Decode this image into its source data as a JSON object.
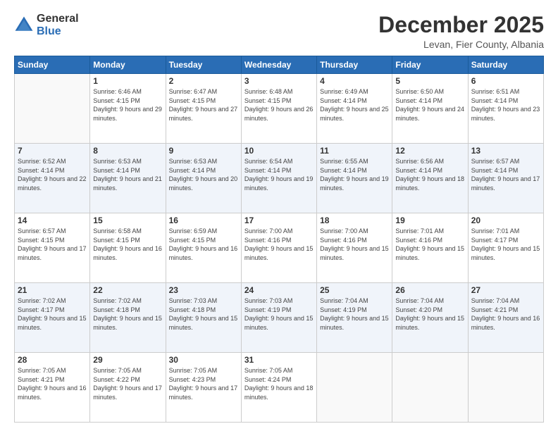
{
  "logo": {
    "general": "General",
    "blue": "Blue"
  },
  "title": {
    "month": "December 2025",
    "location": "Levan, Fier County, Albania"
  },
  "weekdays": [
    "Sunday",
    "Monday",
    "Tuesday",
    "Wednesday",
    "Thursday",
    "Friday",
    "Saturday"
  ],
  "weeks": [
    [
      {
        "day": "",
        "sunrise": "",
        "sunset": "",
        "daylight": ""
      },
      {
        "day": "1",
        "sunrise": "Sunrise: 6:46 AM",
        "sunset": "Sunset: 4:15 PM",
        "daylight": "Daylight: 9 hours and 29 minutes."
      },
      {
        "day": "2",
        "sunrise": "Sunrise: 6:47 AM",
        "sunset": "Sunset: 4:15 PM",
        "daylight": "Daylight: 9 hours and 27 minutes."
      },
      {
        "day": "3",
        "sunrise": "Sunrise: 6:48 AM",
        "sunset": "Sunset: 4:15 PM",
        "daylight": "Daylight: 9 hours and 26 minutes."
      },
      {
        "day": "4",
        "sunrise": "Sunrise: 6:49 AM",
        "sunset": "Sunset: 4:14 PM",
        "daylight": "Daylight: 9 hours and 25 minutes."
      },
      {
        "day": "5",
        "sunrise": "Sunrise: 6:50 AM",
        "sunset": "Sunset: 4:14 PM",
        "daylight": "Daylight: 9 hours and 24 minutes."
      },
      {
        "day": "6",
        "sunrise": "Sunrise: 6:51 AM",
        "sunset": "Sunset: 4:14 PM",
        "daylight": "Daylight: 9 hours and 23 minutes."
      }
    ],
    [
      {
        "day": "7",
        "sunrise": "Sunrise: 6:52 AM",
        "sunset": "Sunset: 4:14 PM",
        "daylight": "Daylight: 9 hours and 22 minutes."
      },
      {
        "day": "8",
        "sunrise": "Sunrise: 6:53 AM",
        "sunset": "Sunset: 4:14 PM",
        "daylight": "Daylight: 9 hours and 21 minutes."
      },
      {
        "day": "9",
        "sunrise": "Sunrise: 6:53 AM",
        "sunset": "Sunset: 4:14 PM",
        "daylight": "Daylight: 9 hours and 20 minutes."
      },
      {
        "day": "10",
        "sunrise": "Sunrise: 6:54 AM",
        "sunset": "Sunset: 4:14 PM",
        "daylight": "Daylight: 9 hours and 19 minutes."
      },
      {
        "day": "11",
        "sunrise": "Sunrise: 6:55 AM",
        "sunset": "Sunset: 4:14 PM",
        "daylight": "Daylight: 9 hours and 19 minutes."
      },
      {
        "day": "12",
        "sunrise": "Sunrise: 6:56 AM",
        "sunset": "Sunset: 4:14 PM",
        "daylight": "Daylight: 9 hours and 18 minutes."
      },
      {
        "day": "13",
        "sunrise": "Sunrise: 6:57 AM",
        "sunset": "Sunset: 4:14 PM",
        "daylight": "Daylight: 9 hours and 17 minutes."
      }
    ],
    [
      {
        "day": "14",
        "sunrise": "Sunrise: 6:57 AM",
        "sunset": "Sunset: 4:15 PM",
        "daylight": "Daylight: 9 hours and 17 minutes."
      },
      {
        "day": "15",
        "sunrise": "Sunrise: 6:58 AM",
        "sunset": "Sunset: 4:15 PM",
        "daylight": "Daylight: 9 hours and 16 minutes."
      },
      {
        "day": "16",
        "sunrise": "Sunrise: 6:59 AM",
        "sunset": "Sunset: 4:15 PM",
        "daylight": "Daylight: 9 hours and 16 minutes."
      },
      {
        "day": "17",
        "sunrise": "Sunrise: 7:00 AM",
        "sunset": "Sunset: 4:16 PM",
        "daylight": "Daylight: 9 hours and 15 minutes."
      },
      {
        "day": "18",
        "sunrise": "Sunrise: 7:00 AM",
        "sunset": "Sunset: 4:16 PM",
        "daylight": "Daylight: 9 hours and 15 minutes."
      },
      {
        "day": "19",
        "sunrise": "Sunrise: 7:01 AM",
        "sunset": "Sunset: 4:16 PM",
        "daylight": "Daylight: 9 hours and 15 minutes."
      },
      {
        "day": "20",
        "sunrise": "Sunrise: 7:01 AM",
        "sunset": "Sunset: 4:17 PM",
        "daylight": "Daylight: 9 hours and 15 minutes."
      }
    ],
    [
      {
        "day": "21",
        "sunrise": "Sunrise: 7:02 AM",
        "sunset": "Sunset: 4:17 PM",
        "daylight": "Daylight: 9 hours and 15 minutes."
      },
      {
        "day": "22",
        "sunrise": "Sunrise: 7:02 AM",
        "sunset": "Sunset: 4:18 PM",
        "daylight": "Daylight: 9 hours and 15 minutes."
      },
      {
        "day": "23",
        "sunrise": "Sunrise: 7:03 AM",
        "sunset": "Sunset: 4:18 PM",
        "daylight": "Daylight: 9 hours and 15 minutes."
      },
      {
        "day": "24",
        "sunrise": "Sunrise: 7:03 AM",
        "sunset": "Sunset: 4:19 PM",
        "daylight": "Daylight: 9 hours and 15 minutes."
      },
      {
        "day": "25",
        "sunrise": "Sunrise: 7:04 AM",
        "sunset": "Sunset: 4:19 PM",
        "daylight": "Daylight: 9 hours and 15 minutes."
      },
      {
        "day": "26",
        "sunrise": "Sunrise: 7:04 AM",
        "sunset": "Sunset: 4:20 PM",
        "daylight": "Daylight: 9 hours and 15 minutes."
      },
      {
        "day": "27",
        "sunrise": "Sunrise: 7:04 AM",
        "sunset": "Sunset: 4:21 PM",
        "daylight": "Daylight: 9 hours and 16 minutes."
      }
    ],
    [
      {
        "day": "28",
        "sunrise": "Sunrise: 7:05 AM",
        "sunset": "Sunset: 4:21 PM",
        "daylight": "Daylight: 9 hours and 16 minutes."
      },
      {
        "day": "29",
        "sunrise": "Sunrise: 7:05 AM",
        "sunset": "Sunset: 4:22 PM",
        "daylight": "Daylight: 9 hours and 17 minutes."
      },
      {
        "day": "30",
        "sunrise": "Sunrise: 7:05 AM",
        "sunset": "Sunset: 4:23 PM",
        "daylight": "Daylight: 9 hours and 17 minutes."
      },
      {
        "day": "31",
        "sunrise": "Sunrise: 7:05 AM",
        "sunset": "Sunset: 4:24 PM",
        "daylight": "Daylight: 9 hours and 18 minutes."
      },
      {
        "day": "",
        "sunrise": "",
        "sunset": "",
        "daylight": ""
      },
      {
        "day": "",
        "sunrise": "",
        "sunset": "",
        "daylight": ""
      },
      {
        "day": "",
        "sunrise": "",
        "sunset": "",
        "daylight": ""
      }
    ]
  ]
}
